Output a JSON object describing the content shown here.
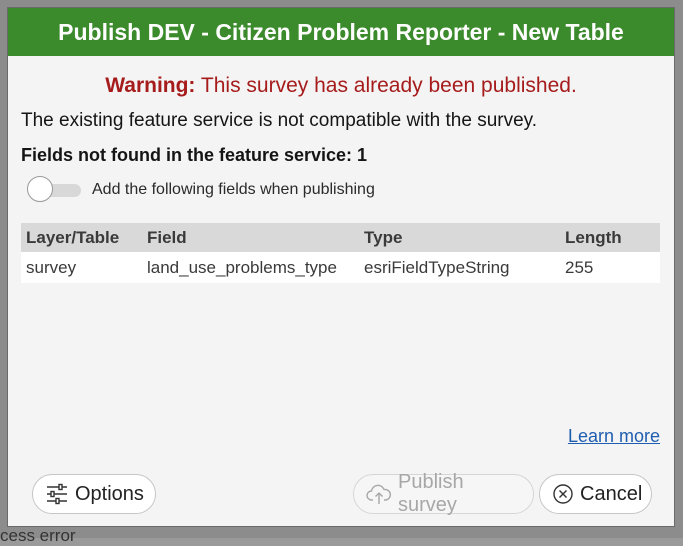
{
  "dialog": {
    "title": "Publish DEV - Citizen Problem Reporter - New Table",
    "warning_label": "Warning:",
    "warning_text": " This survey has already been published.",
    "incompatible_text": "The existing feature service is not compatible with the survey.",
    "fields_not_found": "Fields not found in the feature service: 1",
    "toggle": {
      "label": "Add the following fields when publishing",
      "on": false
    },
    "table": {
      "headers": [
        "Layer/Table",
        "Field",
        "Type",
        "Length"
      ],
      "rows": [
        [
          "survey",
          "land_use_problems_type",
          "esriFieldTypeString",
          "255"
        ]
      ]
    },
    "learn_more": "Learn more",
    "buttons": {
      "options": "Options",
      "publish": "Publish survey",
      "cancel": "Cancel"
    }
  },
  "background": {
    "fragment": "cess error"
  },
  "colors": {
    "titlebar": "#3b8a2b",
    "warning": "#a61c1c",
    "link": "#1f5db0"
  },
  "icons": {
    "options": "sliders-icon",
    "publish": "cloud-upload-icon",
    "cancel": "x-circle-icon"
  }
}
